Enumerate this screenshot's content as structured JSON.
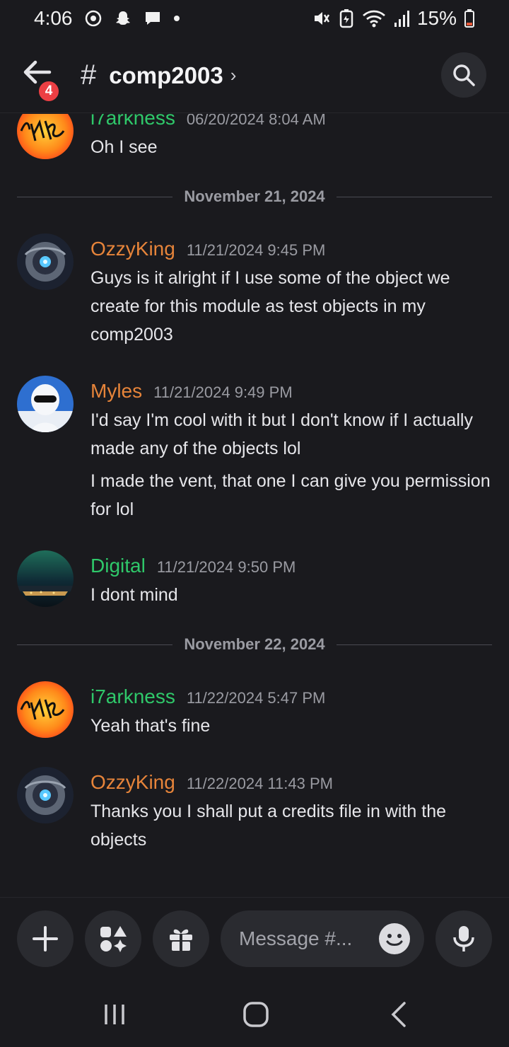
{
  "status_bar": {
    "time": "4:06",
    "battery": "15%",
    "icons": [
      "whatsapp-icon",
      "snapchat-icon",
      "chat-icon",
      "dot-icon",
      "mute-icon",
      "battery-saver-icon",
      "wifi-icon",
      "signal-icon",
      "battery-icon"
    ]
  },
  "header": {
    "back_badge": "4",
    "hash": "#",
    "channel_name": "comp2003",
    "chevron": "›"
  },
  "messages": [
    {
      "author": "i7arkness",
      "timestamp": "06/20/2024 8:04 AM",
      "lines": [
        "Oh I see"
      ],
      "author_color": "#2fc86a"
    },
    {
      "author": "OzzyKing",
      "timestamp": "11/21/2024 9:45 PM",
      "lines": [
        "Guys is it alright if I use some of the object we create for this module as test objects in my comp2003"
      ],
      "author_color": "#e6843a"
    },
    {
      "author": "Myles",
      "timestamp": "11/21/2024 9:49 PM",
      "lines": [
        "I'd say I'm cool with it but I don't know if I actually made any of the objects lol",
        "I made the vent, that one I can give you permission for lol"
      ],
      "author_color": "#e6843a"
    },
    {
      "author": "Digital",
      "timestamp": "11/21/2024 9:50 PM",
      "lines": [
        "I dont mind"
      ],
      "author_color": "#2fc86a"
    },
    {
      "author": "i7arkness",
      "timestamp": "11/22/2024 5:47 PM",
      "lines": [
        "Yeah that's fine"
      ],
      "author_color": "#2fc86a"
    },
    {
      "author": "OzzyKing",
      "timestamp": "11/22/2024 11:43 PM",
      "lines": [
        "Thanks you I shall put a credits file in with the objects"
      ],
      "author_color": "#e6843a"
    }
  ],
  "dividers": [
    "November 21, 2024",
    "November 22, 2024"
  ],
  "composer": {
    "placeholder": "Message #..."
  },
  "colors": {
    "background": "#1a1a1e",
    "surface": "#2a2b30",
    "orange_role": "#e6843a",
    "green_role": "#2fc86a",
    "badge": "#ec3f44"
  }
}
